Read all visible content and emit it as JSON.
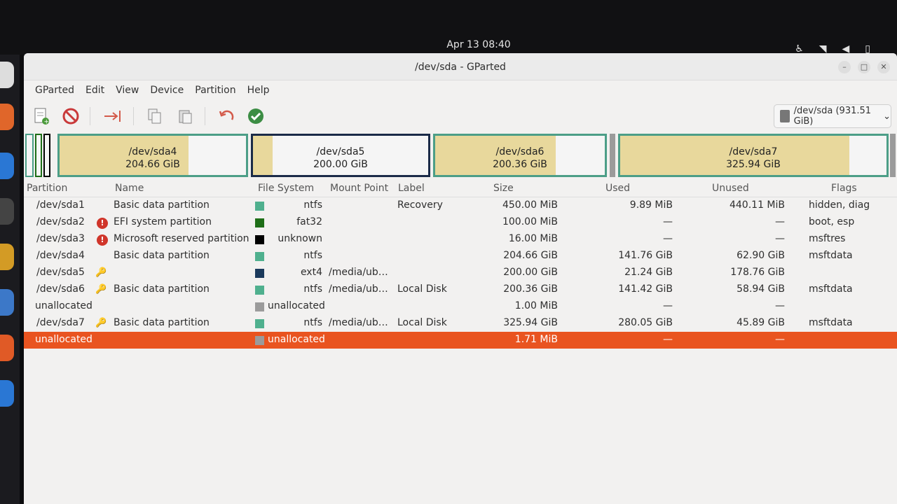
{
  "topbar": {
    "clock": "Apr 13  08:40"
  },
  "window": {
    "title": "/dev/sda - GParted",
    "menu": [
      "GParted",
      "Edit",
      "View",
      "Device",
      "Partition",
      "Help"
    ],
    "device_selector": "/dev/sda (931.51 GiB)"
  },
  "map": [
    {
      "name": "/dev/sda4",
      "size": "204.66 GiB",
      "used_fraction": 0.69
    },
    {
      "name": "/dev/sda5",
      "size": "200.00 GiB",
      "used_fraction": 0.11
    },
    {
      "name": "/dev/sda6",
      "size": "200.36 GiB",
      "used_fraction": 0.71
    },
    {
      "name": "/dev/sda7",
      "size": "325.94 GiB",
      "used_fraction": 0.86
    }
  ],
  "columns": {
    "partition": "Partition",
    "name": "Name",
    "filesystem": "File System",
    "mount": "Mount Point",
    "label": "Label",
    "size": "Size",
    "used": "Used",
    "unused": "Unused",
    "flags": "Flags"
  },
  "rows": [
    {
      "partition": "/dev/sda1",
      "name": "Basic data partition",
      "fs": "ntfs",
      "fs_color": "#4fb08e",
      "mount": "",
      "label": "Recovery",
      "size": "450.00 MiB",
      "used": "9.89 MiB",
      "unused": "440.11 MiB",
      "flags": "hidden, diag",
      "status": ""
    },
    {
      "partition": "/dev/sda2",
      "name": "EFI system partition",
      "fs": "fat32",
      "fs_color": "#1e6e17",
      "mount": "",
      "label": "",
      "size": "100.00 MiB",
      "used": "—",
      "unused": "—",
      "flags": "boot, esp",
      "status": "warning"
    },
    {
      "partition": "/dev/sda3",
      "name": "Microsoft reserved partition",
      "fs": "unknown",
      "fs_color": "#000000",
      "mount": "",
      "label": "",
      "size": "16.00 MiB",
      "used": "—",
      "unused": "—",
      "flags": "msftres",
      "status": "warning"
    },
    {
      "partition": "/dev/sda4",
      "name": "Basic data partition",
      "fs": "ntfs",
      "fs_color": "#4fb08e",
      "mount": "",
      "label": "",
      "size": "204.66 GiB",
      "used": "141.76 GiB",
      "unused": "62.90 GiB",
      "flags": "msftdata",
      "status": ""
    },
    {
      "partition": "/dev/sda5",
      "name": "",
      "fs": "ext4",
      "fs_color": "#1b3a5c",
      "mount": "/media/ub…",
      "label": "",
      "size": "200.00 GiB",
      "used": "21.24 GiB",
      "unused": "178.76 GiB",
      "flags": "",
      "status": "mounted"
    },
    {
      "partition": "/dev/sda6",
      "name": "Basic data partition",
      "fs": "ntfs",
      "fs_color": "#4fb08e",
      "mount": "/media/ub…",
      "label": "Local Disk",
      "size": "200.36 GiB",
      "used": "141.42 GiB",
      "unused": "58.94 GiB",
      "flags": "msftdata",
      "status": "mounted"
    },
    {
      "partition": "unallocated",
      "name": "",
      "fs": "unallocated",
      "fs_color": "#9b9b9b",
      "mount": "",
      "label": "",
      "size": "1.00 MiB",
      "used": "—",
      "unused": "—",
      "flags": "",
      "status": ""
    },
    {
      "partition": "/dev/sda7",
      "name": "Basic data partition",
      "fs": "ntfs",
      "fs_color": "#4fb08e",
      "mount": "/media/ub…",
      "label": "Local Disk",
      "size": "325.94 GiB",
      "used": "280.05 GiB",
      "unused": "45.89 GiB",
      "flags": "msftdata",
      "status": "mounted"
    },
    {
      "partition": "unallocated",
      "name": "",
      "fs": "unallocated",
      "fs_color": "#9b9b9b",
      "mount": "",
      "label": "",
      "size": "1.71 MiB",
      "used": "—",
      "unused": "—",
      "flags": "",
      "status": "selected"
    }
  ]
}
